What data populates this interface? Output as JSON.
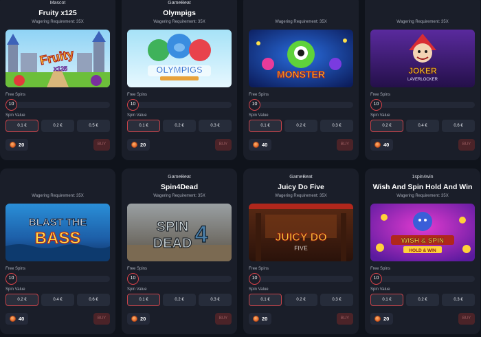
{
  "labels": {
    "free_spins": "Free Spins",
    "spin_value": "Spin Value",
    "buy": "BUY"
  },
  "colors": {
    "background": "#0f131b",
    "card": "#1a1e29",
    "accent_red": "#d8434a",
    "coin": "#e2662a"
  },
  "cards": [
    {
      "provider": "Mascot",
      "title": "Fruity x125",
      "wagering": "Wagering Requirement: 35X",
      "free_spins": "10",
      "values": [
        "0.1 €",
        "0.2 €",
        "0.5 €"
      ],
      "selected_value_index": 0,
      "price": "20",
      "banner_icon": "fruity-x125-logo"
    },
    {
      "provider": "GameBeat",
      "title": "Olympigs",
      "wagering": "Wagering Requirement: 35X",
      "free_spins": "10",
      "values": [
        "0.1 €",
        "0.2 €",
        "0.3 €"
      ],
      "selected_value_index": 0,
      "price": "20",
      "banner_icon": "olympigs-logo"
    },
    {
      "provider": "",
      "title": "",
      "wagering": "Wagering Requirement: 35X",
      "free_spins": "10",
      "values": [
        "0.1 €",
        "0.2 €",
        "0.3 €"
      ],
      "selected_value_index": 0,
      "price": "40",
      "banner_icon": "monster-logo"
    },
    {
      "provider": "",
      "title": "",
      "wagering": "Wagering Requirement: 35X",
      "free_spins": "10",
      "values": [
        "0.2 €",
        "0.4 €",
        "0.6 €"
      ],
      "selected_value_index": 0,
      "price": "40",
      "banner_icon": "joker-logo"
    },
    {
      "provider": "",
      "title": "",
      "wagering": "Wagering Requirement: 35X",
      "free_spins": "10",
      "values": [
        "0.2 €",
        "0.4 €",
        "0.6 €"
      ],
      "selected_value_index": 0,
      "price": "40",
      "banner_icon": "blast-the-bass-logo"
    },
    {
      "provider": "GameBeat",
      "title": "Spin4Dead",
      "wagering": "Wagering Requirement: 35X",
      "free_spins": "10",
      "values": [
        "0.1 €",
        "0.2 €",
        "0.3 €"
      ],
      "selected_value_index": 0,
      "price": "20",
      "banner_icon": "spin4dead-logo"
    },
    {
      "provider": "GameBeat",
      "title": "Juicy Do Five",
      "wagering": "Wagering Requirement: 35X",
      "free_spins": "10",
      "values": [
        "0.1 €",
        "0.2 €",
        "0.3 €"
      ],
      "selected_value_index": 0,
      "price": "20",
      "banner_icon": "juicy-do-five-logo"
    },
    {
      "provider": "1spin4win",
      "title": "Wish And Spin Hold And Win",
      "wagering": "Wagering Requirement: 35X",
      "free_spins": "10",
      "values": [
        "0.1 €",
        "0.2 €",
        "0.3 €"
      ],
      "selected_value_index": 0,
      "price": "20",
      "banner_icon": "wish-and-spin-logo"
    }
  ],
  "banners": {
    "fruity": {
      "line1": "Fruity",
      "line2": "x125"
    },
    "olympigs": {
      "line1": "OLYMPIGS"
    },
    "monster": {
      "line1": "MONSTER"
    },
    "joker": {
      "line1": "JOKER",
      "line2": "LAVERLOCKER"
    },
    "bass": {
      "line1": "BLAST THE",
      "line2": "BASS"
    },
    "spin4dead": {
      "line1": "SPIN",
      "line2": "DEAD",
      "digit": "4"
    },
    "juicy": {
      "line1": "JUICY DO",
      "line2": "FIVE"
    },
    "wish": {
      "line1": "WISH & SPIN",
      "line2": "HOLD & WIN"
    }
  }
}
